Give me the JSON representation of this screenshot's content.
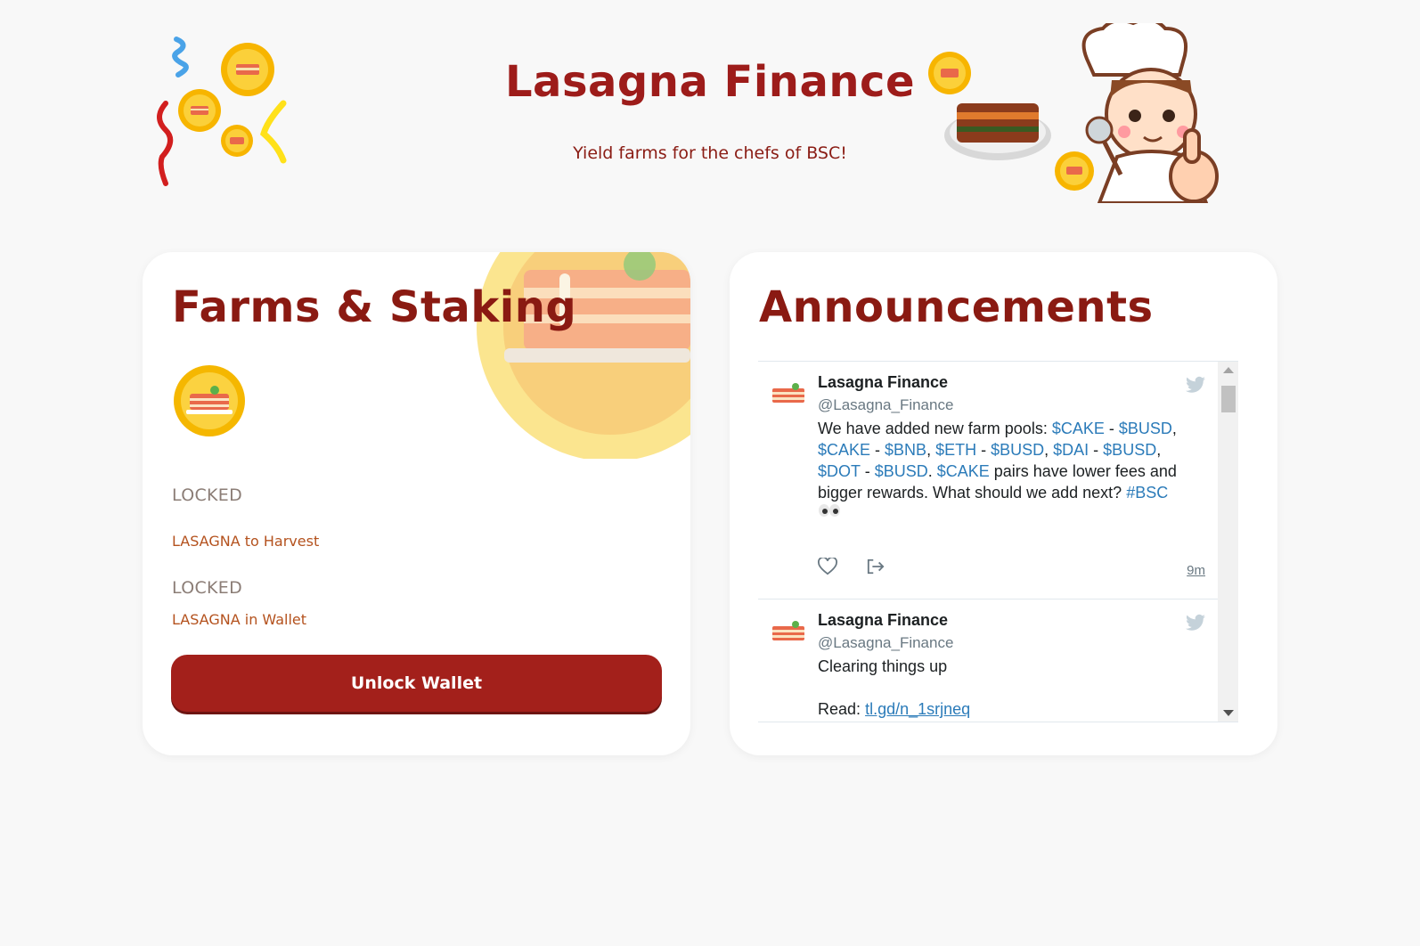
{
  "header": {
    "title": "Lasagna Finance",
    "subtitle": "Yield farms for the chefs of BSC!",
    "confetti_icon": "confetti-coins",
    "mascot_icon": "chef-mascot"
  },
  "farms": {
    "title": "Farms & Staking",
    "coin_icon": "lasagna-coin",
    "harvest_value": "LOCKED",
    "harvest_label": "LASAGNA to Harvest",
    "wallet_value": "LOCKED",
    "wallet_label": "LASAGNA in Wallet",
    "unlock_button": "Unlock Wallet"
  },
  "announcements": {
    "title": "Announcements",
    "tweets": [
      {
        "name": "Lasagna Finance",
        "handle": "@Lasagna_Finance",
        "text": "We have added new farm pools: $CAKE - $BUSD, $CAKE - $BNB, $ETH - $BUSD, $DAI - $BUSD, $DOT - $BUSD. $CAKE pairs have lower fees and bigger rewards. What should we add next? #BSC",
        "time": "9m"
      },
      {
        "name": "Lasagna Finance",
        "handle": "@Lasagna_Finance",
        "text": "Clearing things up",
        "read_prefix": "Read:",
        "link": "tl.gd/n_1srjneq"
      }
    ]
  },
  "colors": {
    "brand": "#9d1c1a",
    "button": "#a3201b",
    "link": "#2b7bb9",
    "background": "#f8f8f8"
  }
}
